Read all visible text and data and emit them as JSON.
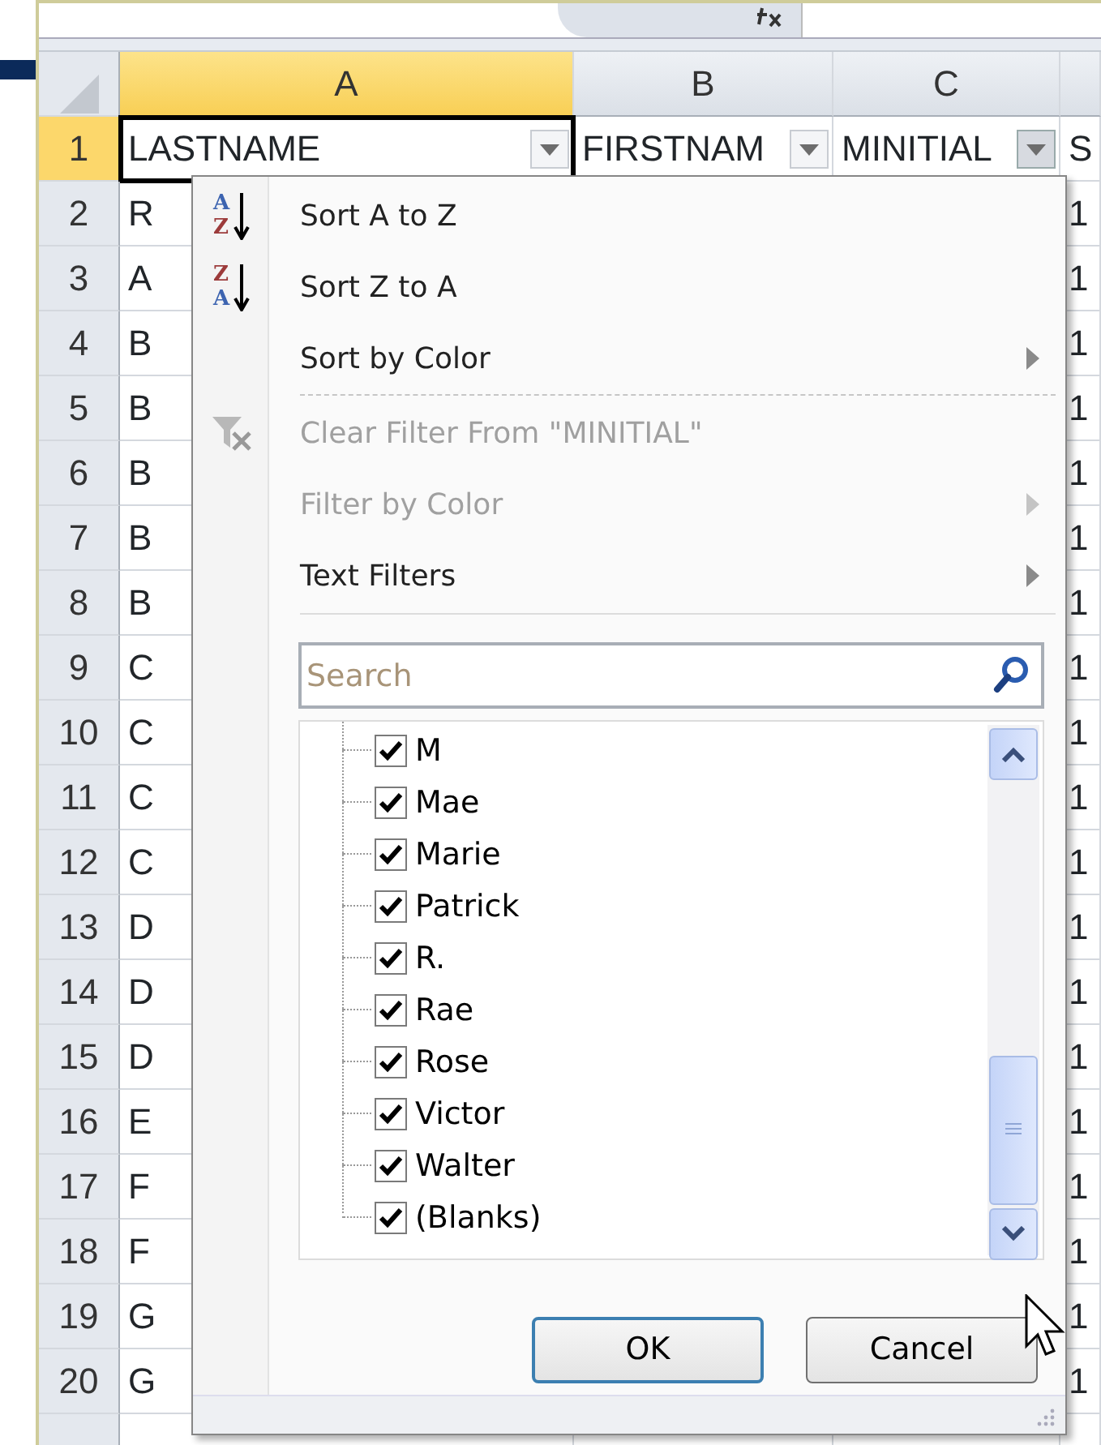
{
  "columns": [
    {
      "label": "A",
      "selected": true
    },
    {
      "label": "B",
      "selected": false
    },
    {
      "label": "C",
      "selected": false
    },
    {
      "selected": false
    }
  ],
  "header_row": {
    "number": "1",
    "selected": true,
    "cells": [
      {
        "text": "LASTNAME",
        "filter_open": false
      },
      {
        "text": "FIRSTNAM",
        "filter_open": false
      },
      {
        "text": "MINITIAL",
        "filter_open": true
      },
      {
        "text": "S"
      }
    ]
  },
  "rows": [
    {
      "number": "2",
      "column_a": "R",
      "column_d": "1"
    },
    {
      "number": "3",
      "column_a": "A",
      "column_d": "1"
    },
    {
      "number": "4",
      "column_a": "B",
      "column_d": "1"
    },
    {
      "number": "5",
      "column_a": "B",
      "column_d": "1"
    },
    {
      "number": "6",
      "column_a": "B",
      "column_d": "1"
    },
    {
      "number": "7",
      "column_a": "B",
      "column_d": "1"
    },
    {
      "number": "8",
      "column_a": "B",
      "column_d": "1"
    },
    {
      "number": "9",
      "column_a": "C",
      "column_d": "1"
    },
    {
      "number": "10",
      "column_a": "C",
      "column_d": "1"
    },
    {
      "number": "11",
      "column_a": "C",
      "column_d": "1"
    },
    {
      "number": "12",
      "column_a": "C",
      "column_d": "1"
    },
    {
      "number": "13",
      "column_a": "D",
      "column_d": "1"
    },
    {
      "number": "14",
      "column_a": "D",
      "column_d": "1"
    },
    {
      "number": "15",
      "column_a": "D",
      "column_d": "1"
    },
    {
      "number": "16",
      "column_a": "E",
      "column_d": "1"
    },
    {
      "number": "17",
      "column_a": "F",
      "column_d": "1"
    },
    {
      "number": "18",
      "column_a": "F",
      "column_d": "1"
    },
    {
      "number": "19",
      "column_a": "G",
      "column_d": "1"
    },
    {
      "number": "20",
      "column_a": "G",
      "column_d": "1"
    }
  ],
  "filter_menu": {
    "items": [
      {
        "kind": "sort",
        "label": "Sort A to Z",
        "icon_top": "A",
        "icon_bottom": "Z",
        "disabled": false,
        "submenu": false
      },
      {
        "kind": "sort",
        "label": "Sort Z to A",
        "icon_top": "Z",
        "icon_bottom": "A",
        "disabled": false,
        "submenu": false
      },
      {
        "kind": "command",
        "label": "Sort by Color",
        "disabled": false,
        "submenu": true
      },
      {
        "kind": "separator"
      },
      {
        "kind": "clear_filter",
        "label": "Clear Filter From \"MINITIAL\"",
        "disabled": true,
        "submenu": false
      },
      {
        "kind": "command",
        "label": "Filter by Color",
        "disabled": true,
        "submenu": true
      },
      {
        "kind": "command",
        "label": "Text Filters",
        "disabled": false,
        "submenu": true
      }
    ],
    "search": {
      "placeholder": "Search"
    },
    "values": [
      {
        "label": "M",
        "checked": true
      },
      {
        "label": "Mae",
        "checked": true
      },
      {
        "label": "Marie",
        "checked": true
      },
      {
        "label": "Patrick",
        "checked": true
      },
      {
        "label": "R.",
        "checked": true
      },
      {
        "label": "Rae",
        "checked": true
      },
      {
        "label": "Rose",
        "checked": true
      },
      {
        "label": "Victor",
        "checked": true
      },
      {
        "label": "Walter",
        "checked": true
      },
      {
        "label": "(Blanks)",
        "checked": true
      }
    ],
    "buttons": [
      {
        "label": "OK",
        "default": true
      },
      {
        "label": "Cancel",
        "default": false
      }
    ]
  }
}
